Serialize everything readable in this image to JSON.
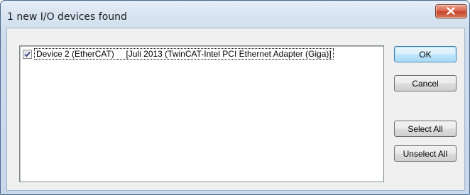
{
  "window": {
    "title": "1 new I/O devices found"
  },
  "list": {
    "items": [
      {
        "checked": true,
        "label": "Device 2 (EtherCAT)     [Juli 2013 (TwinCAT-Intel PCI Ethernet Adapter (Giga)]"
      }
    ]
  },
  "buttons": {
    "ok": "OK",
    "cancel": "Cancel",
    "select_all": "Select All",
    "unselect_all": "Unselect All"
  },
  "colors": {
    "close_button": "#c8412a",
    "default_button_border": "#3c7fb1",
    "title_gradient_top": "#e7eef7"
  }
}
